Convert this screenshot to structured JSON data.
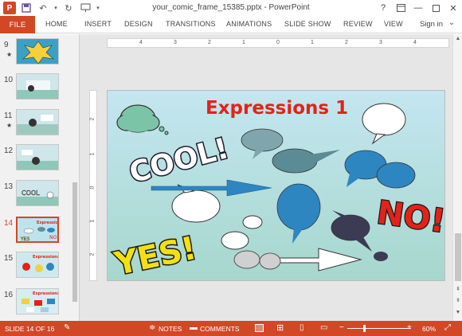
{
  "app": {
    "title": "your_comic_frame_15385.pptx - PowerPoint",
    "help_label": "?"
  },
  "ribbon": {
    "file_label": "FILE",
    "tabs": [
      "HOME",
      "INSERT",
      "DESIGN",
      "TRANSITIONS",
      "ANIMATIONS",
      "SLIDE SHOW",
      "REVIEW",
      "VIEW"
    ],
    "signin_label": "Sign in"
  },
  "thumbnails": [
    {
      "number": "9",
      "starred": true
    },
    {
      "number": "10",
      "starred": false
    },
    {
      "number": "11",
      "starred": true
    },
    {
      "number": "12",
      "starred": false
    },
    {
      "number": "13",
      "starred": false
    },
    {
      "number": "14",
      "starred": false,
      "active": true
    },
    {
      "number": "15",
      "starred": false
    },
    {
      "number": "16",
      "starred": false
    }
  ],
  "ruler": {
    "h_labels": [
      "4",
      "3",
      "2",
      "1",
      "0",
      "1",
      "2",
      "3",
      "4"
    ],
    "v_labels": [
      "2",
      "1",
      "0",
      "1",
      "2"
    ]
  },
  "slide": {
    "title": "Expressions 1",
    "words": {
      "cool": "COOL!",
      "yes": "YES!",
      "no": "NO!"
    }
  },
  "status": {
    "slide_info": "SLIDE 14 OF 16",
    "notes_label": "NOTES",
    "comments_label": "COMMENTS",
    "zoom_level": "60%"
  },
  "colors": {
    "accent": "#d24726",
    "slide_title": "#e2231a"
  }
}
